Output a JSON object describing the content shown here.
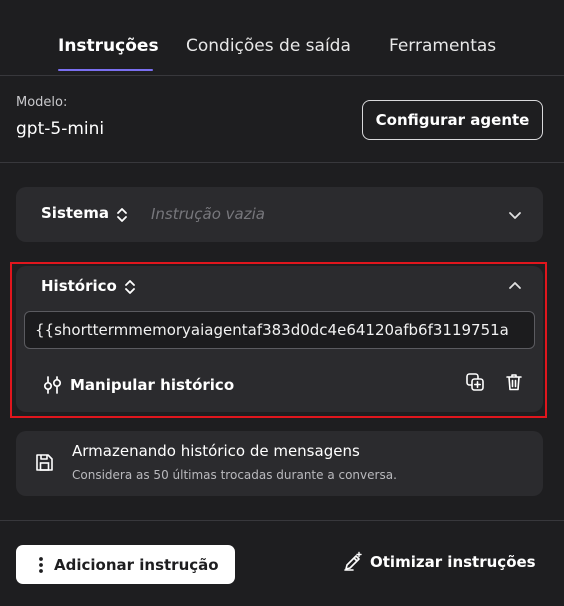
{
  "tabs": [
    {
      "label": "Instruções",
      "active": true
    },
    {
      "label": "Condições de saída",
      "active": false
    },
    {
      "label": "Ferramentas",
      "active": false
    }
  ],
  "model": {
    "label": "Modelo:",
    "value": "gpt-5-mini"
  },
  "config_button": "Configurar agente",
  "system_section": {
    "title": "Sistema",
    "placeholder": "Instrução vazia",
    "expanded": false
  },
  "history_section": {
    "title": "Histórico",
    "expanded": true,
    "highlighted": true,
    "value": "{{shorttermmemoryaiagentaf383d0dc4e64120afb6f3119751a",
    "handle_label": "Manipular histórico"
  },
  "storage": {
    "title": "Armazenando histórico de mensagens",
    "subtitle": "Considera as 50 últimas trocadas durante a conversa."
  },
  "add_button": "Adicionar instrução",
  "optimize_button": "Otimizar instruções",
  "colors": {
    "background": "#1e1e20",
    "card": "#2b2b2e",
    "accent": "#7a6ff0",
    "highlight_border": "#e0161d"
  }
}
